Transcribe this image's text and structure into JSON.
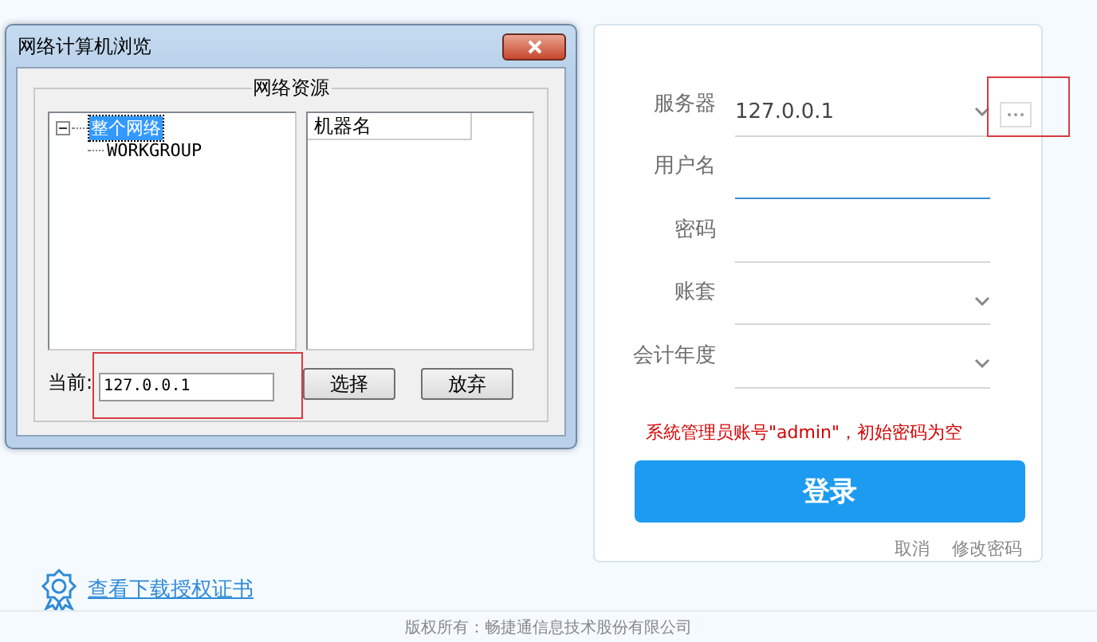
{
  "dialog": {
    "title": "网络计算机浏览",
    "group_label": "网络资源",
    "tree": [
      {
        "label": "整个网络",
        "selected": true,
        "expanded": true,
        "children": [
          {
            "label": "WORKGROUP",
            "selected": false
          }
        ]
      }
    ],
    "list_columns": [
      "机器名"
    ],
    "current": {
      "label": "当前:",
      "value": "127.0.0.1",
      "highlighted": true
    },
    "buttons": [
      "选择",
      "放弃"
    ]
  },
  "login": {
    "fields": [
      {
        "label": "服务器",
        "value": "127.0.0.1",
        "kind": "select",
        "focused": false,
        "more_button": true,
        "highlighted": true
      },
      {
        "label": "用户名",
        "kind": "text",
        "focused": true
      },
      {
        "label": "密码",
        "kind": "text",
        "focused": false
      },
      {
        "label": "账套",
        "kind": "select",
        "focused": false
      },
      {
        "label": "会计年度",
        "kind": "select",
        "focused": false
      }
    ],
    "hint": "系統管理员账号\"admin\"，初始密码为空",
    "submit": "登录",
    "links": [
      "取消",
      "修改密码"
    ]
  },
  "license_link": "查看下载授权证书",
  "footer": "版权所有：畅捷通信息技术股份有限公司"
}
